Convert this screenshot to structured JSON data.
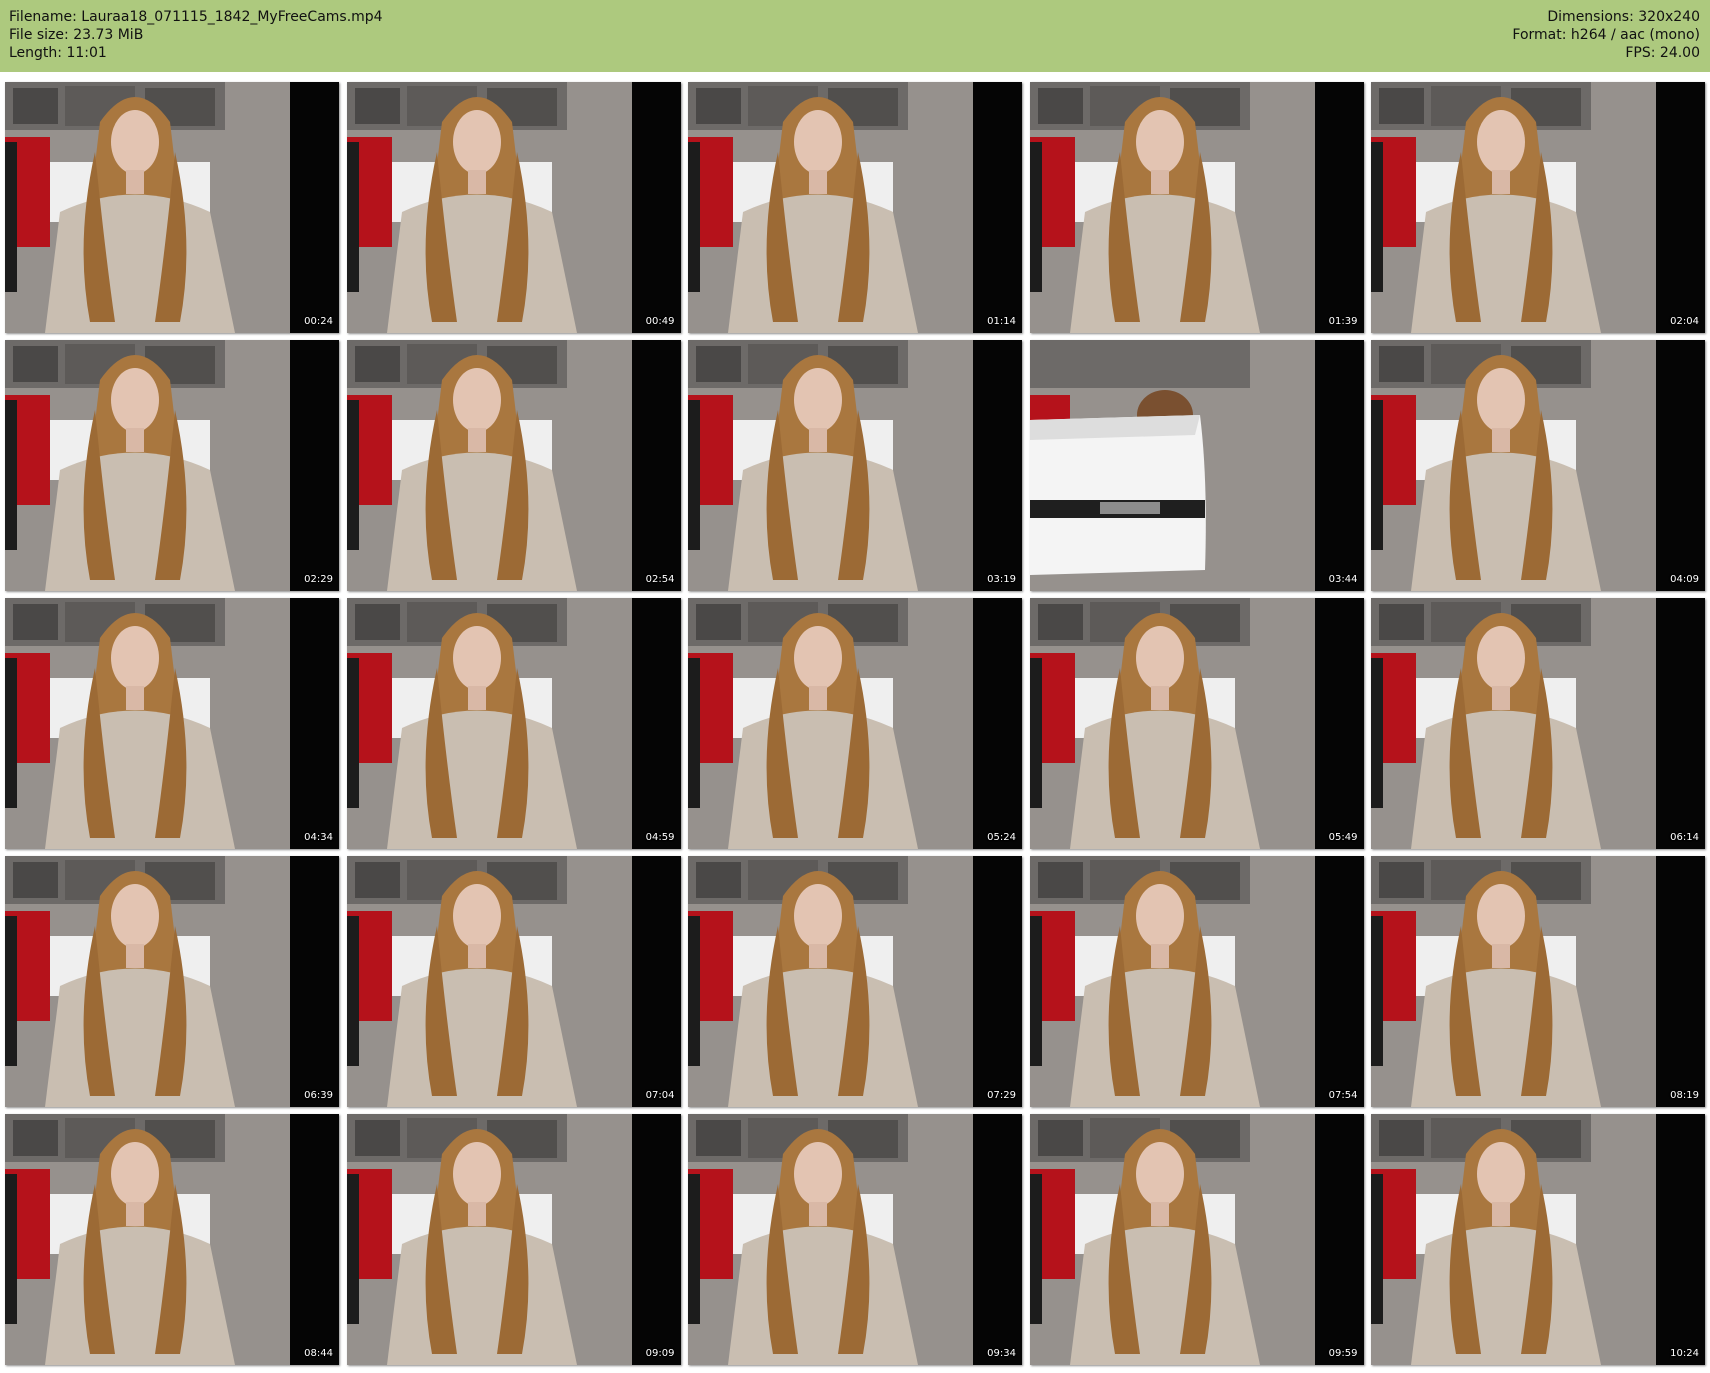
{
  "header": {
    "filename_line": "Filename: Lauraa18_071115_1842_MyFreeCams.mp4",
    "filesize_line": "File size: 23.73 MiB",
    "length_line": "Length: 11:01",
    "dimensions_line": "Dimensions: 320x240",
    "format_line": "Format: h264 / aac (mono)",
    "fps_line": "FPS: 24.00"
  },
  "colors": {
    "header_bg": "#adc97e",
    "page_bg": "#ffffff"
  },
  "thumbnails": [
    {
      "time": "00:24",
      "variant": "person"
    },
    {
      "time": "00:49",
      "variant": "person"
    },
    {
      "time": "01:14",
      "variant": "person"
    },
    {
      "time": "01:39",
      "variant": "person"
    },
    {
      "time": "02:04",
      "variant": "person"
    },
    {
      "time": "02:29",
      "variant": "person"
    },
    {
      "time": "02:54",
      "variant": "person"
    },
    {
      "time": "03:19",
      "variant": "person"
    },
    {
      "time": "03:44",
      "variant": "chair"
    },
    {
      "time": "04:09",
      "variant": "person"
    },
    {
      "time": "04:34",
      "variant": "person"
    },
    {
      "time": "04:59",
      "variant": "person"
    },
    {
      "time": "05:24",
      "variant": "person"
    },
    {
      "time": "05:49",
      "variant": "person"
    },
    {
      "time": "06:14",
      "variant": "person"
    },
    {
      "time": "06:39",
      "variant": "person"
    },
    {
      "time": "07:04",
      "variant": "person"
    },
    {
      "time": "07:29",
      "variant": "person"
    },
    {
      "time": "07:54",
      "variant": "person"
    },
    {
      "time": "08:19",
      "variant": "person"
    },
    {
      "time": "08:44",
      "variant": "person"
    },
    {
      "time": "09:09",
      "variant": "person"
    },
    {
      "time": "09:34",
      "variant": "person"
    },
    {
      "time": "09:59",
      "variant": "person"
    },
    {
      "time": "10:24",
      "variant": "person"
    }
  ]
}
